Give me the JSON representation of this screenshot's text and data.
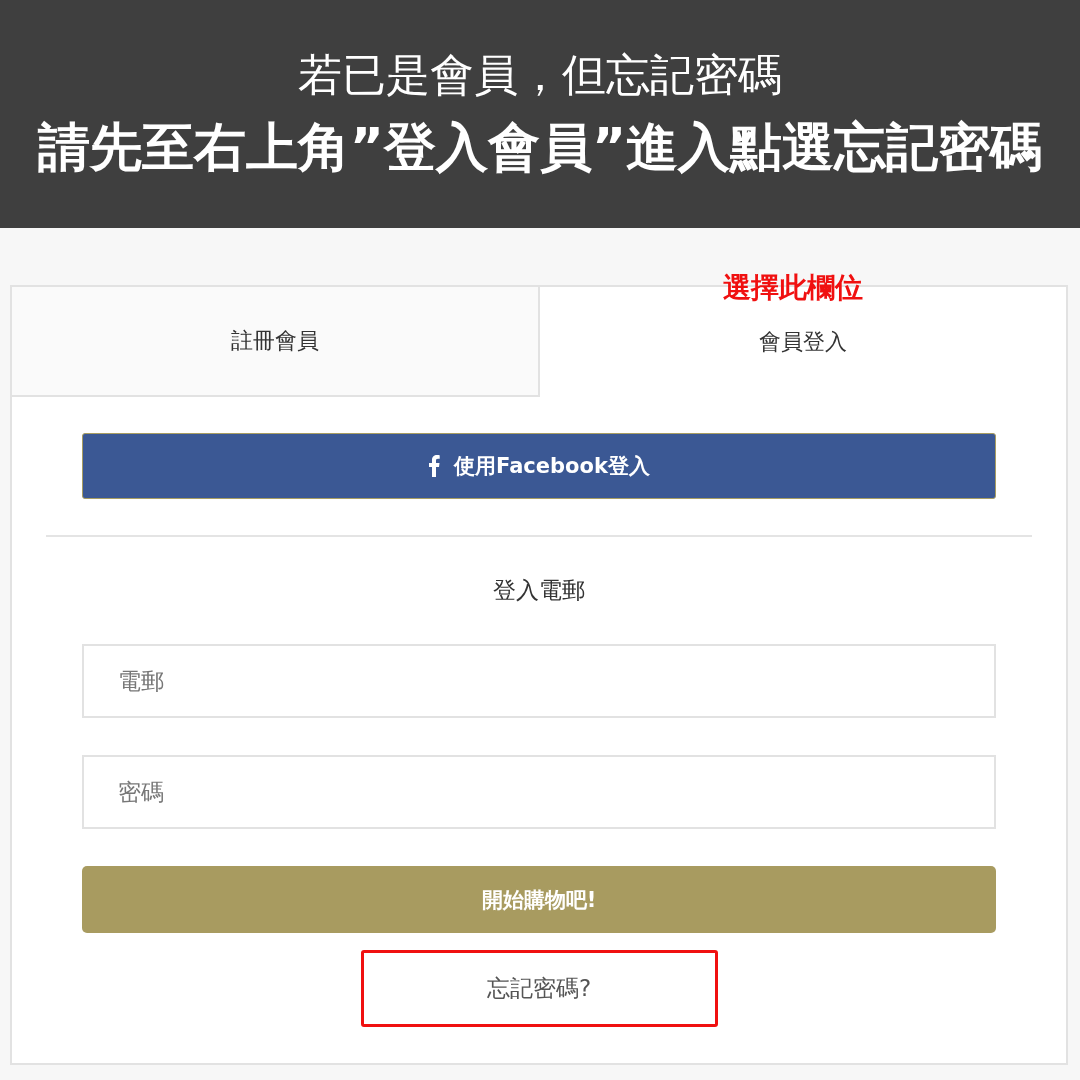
{
  "banner": {
    "lines": [
      "若已是會員，但忘記密碼",
      "請先至右上角”登入會員”進入點選忘記密碼"
    ]
  },
  "annotation": {
    "label": "選擇此欄位"
  },
  "tabs": [
    {
      "label": "註冊會員",
      "selected": false
    },
    {
      "label": "會員登入",
      "selected": true
    }
  ],
  "facebook_button": {
    "label": "使用Facebook登入"
  },
  "form": {
    "heading": "登入電郵",
    "fields": [
      {
        "placeholder": "電郵"
      },
      {
        "placeholder": "密碼"
      }
    ],
    "submit": "開始購物吧!",
    "forgot_password": {
      "label": "忘記密碼?",
      "highlighted": true
    }
  }
}
